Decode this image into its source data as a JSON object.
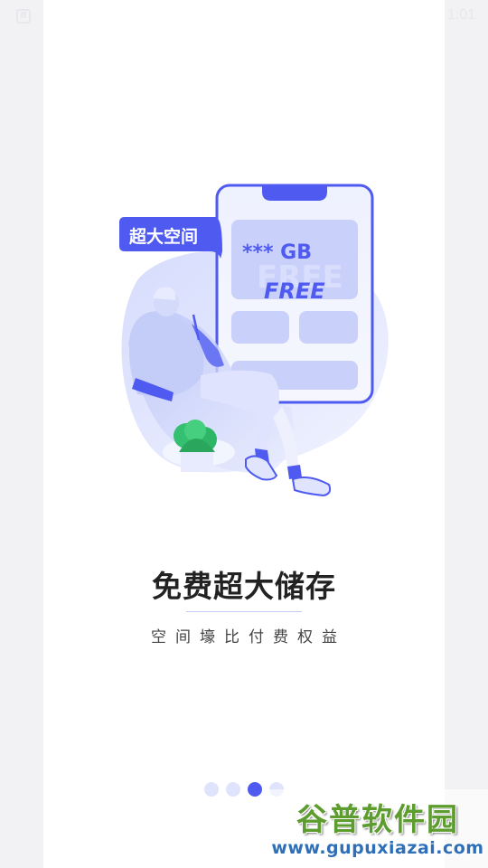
{
  "status_bar": {
    "left_icon_label": "B",
    "time": "1:01"
  },
  "illustration": {
    "bubble_label": "超大空间",
    "storage_value": "*** GB",
    "free_label": "FREE",
    "free_shadow_label": "FREE",
    "colors": {
      "accent": "#4f5bf0",
      "light": "#e4e8fd",
      "panel": "#c9d1fa",
      "plant": "#34c070"
    }
  },
  "onboarding": {
    "title": "免费超大储存",
    "subtitle": "空间壕比付费权益",
    "pager": {
      "total": 4,
      "active_index": 2
    }
  },
  "watermark": {
    "title": "谷普软件园",
    "url": "www.gupuxiazai.com"
  }
}
